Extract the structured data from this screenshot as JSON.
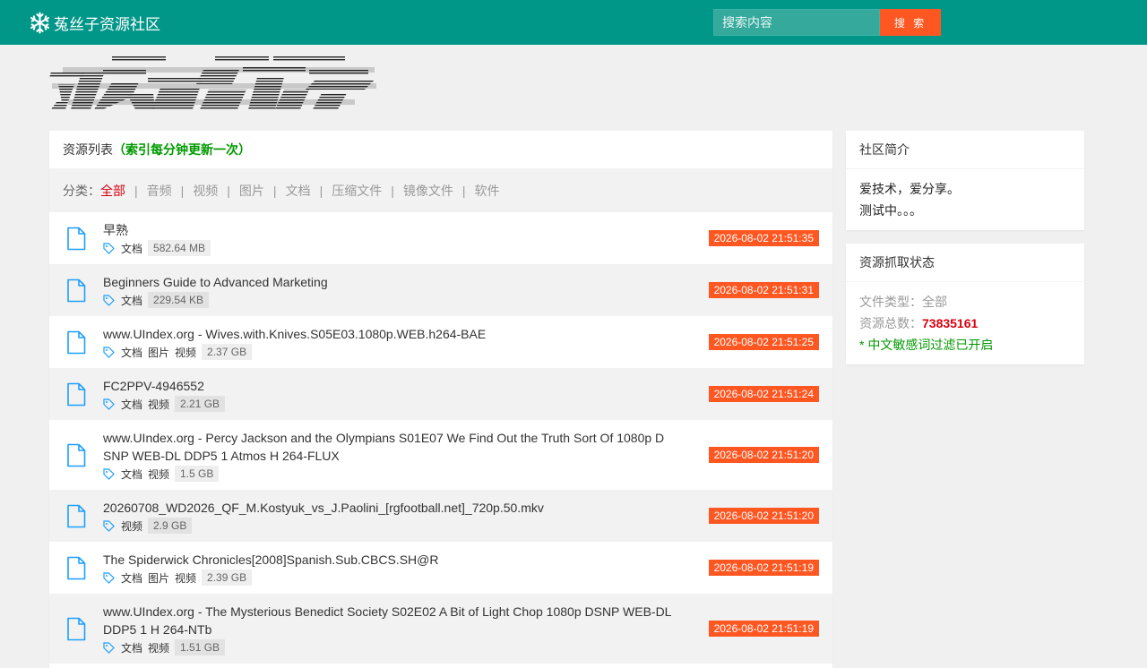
{
  "header": {
    "site_name": "菟丝子资源社区",
    "logo_icon": "snowflake-icon",
    "search_placeholder": "搜索内容",
    "search_button": "搜 索"
  },
  "colors": {
    "topbar": "#009688",
    "search_button": "#ff5722",
    "date_badge": "#ff5722",
    "active_category": "#d7000f",
    "notice": "#009900"
  },
  "list": {
    "heading": "资源列表",
    "notice": "（索引每分钟更新一次）",
    "filter_label": "分类：",
    "categories": [
      "全部",
      "音频",
      "视频",
      "图片",
      "文档",
      "压缩文件",
      "镜像文件",
      "软件"
    ],
    "active_category": "全部",
    "items": [
      {
        "title": "早熟",
        "tags": [
          "文档"
        ],
        "size": "582.64 MB",
        "date": "2026-08-02 21:51:35"
      },
      {
        "title": "Beginners Guide to Advanced Marketing",
        "tags": [
          "文档"
        ],
        "size": "229.54 KB",
        "date": "2026-08-02 21:51:31"
      },
      {
        "title": "www.UIndex.org - Wives.with.Knives.S05E03.1080p.WEB.h264-BAE",
        "tags": [
          "文档",
          "图片",
          "视频"
        ],
        "size": "2.37 GB",
        "date": "2026-08-02 21:51:25"
      },
      {
        "title": "FC2PPV-4946552",
        "tags": [
          "文档",
          "视频"
        ],
        "size": "2.21 GB",
        "date": "2026-08-02 21:51:24"
      },
      {
        "title": "www.UIndex.org - Percy Jackson and the Olympians S01E07 We Find Out the Truth Sort Of 1080p DSNP WEB-DL DDP5 1 Atmos H 264-FLUX",
        "tags": [
          "文档",
          "视频"
        ],
        "size": "1.5 GB",
        "date": "2026-08-02 21:51:20"
      },
      {
        "title": "20260708_WD2026_QF_M.Kostyuk_vs_J.Paolini_[rgfootball.net]_720p.50.mkv",
        "tags": [
          "视频"
        ],
        "size": "2.9 GB",
        "date": "2026-08-02 21:51:20"
      },
      {
        "title": "The Spiderwick Chronicles[2008]Spanish.Sub.CBCS.SH@R",
        "tags": [
          "文档",
          "图片",
          "视频"
        ],
        "size": "2.39 GB",
        "date": "2026-08-02 21:51:19"
      },
      {
        "title": "www.UIndex.org - The Mysterious Benedict Society S02E02 A Bit of Light Chop 1080p DSNP WEB-DL DDP5 1 H 264-NTb",
        "tags": [
          "文档",
          "视频"
        ],
        "size": "1.51 GB",
        "date": "2026-08-02 21:51:19"
      }
    ]
  },
  "intro": {
    "heading": "社区简介",
    "lines": [
      "爱技术，爱分享。",
      "测试中。。。"
    ]
  },
  "status": {
    "heading": "资源抓取状态",
    "type_label": "文件类型：",
    "type_value": "全部",
    "total_label": "资源总数：",
    "total_value": "73835161",
    "filter_note": "* 中文敏感词过滤已开启"
  }
}
